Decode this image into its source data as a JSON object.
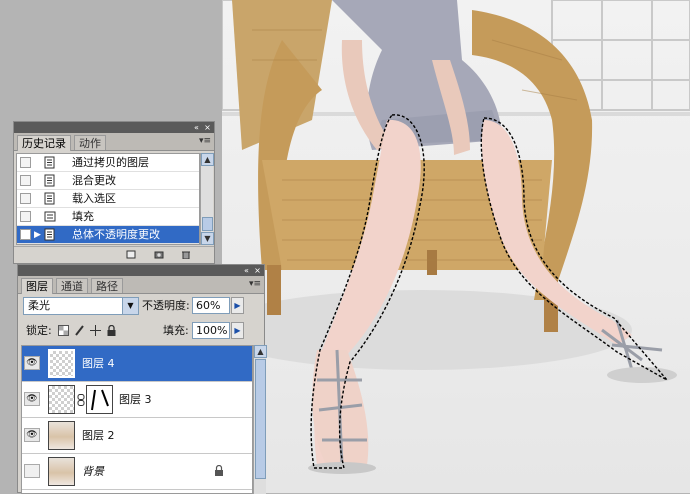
{
  "history_panel": {
    "tabs": [
      "历史记录",
      "动作"
    ],
    "active_tab": "历史记录",
    "items": [
      {
        "label": "通过拷贝的图层",
        "selected": false
      },
      {
        "label": "混合更改",
        "selected": false
      },
      {
        "label": "载入选区",
        "selected": false
      },
      {
        "label": "填充",
        "selected": false
      },
      {
        "label": "总体不透明度更改",
        "selected": true
      }
    ],
    "selection_color": "#316ac5"
  },
  "layers_panel": {
    "tabs": [
      "图层",
      "通道",
      "路径"
    ],
    "active_tab": "图层",
    "blend_mode": "柔光",
    "opacity_label": "不透明度:",
    "opacity_value": "60%",
    "lock_label": "锁定:",
    "fill_label": "填充:",
    "fill_value": "100%",
    "layers": [
      {
        "name": "图层 4",
        "visible": true,
        "selected": true,
        "thumbnail": "transparent",
        "mask": false
      },
      {
        "name": "图层 3",
        "visible": true,
        "selected": false,
        "thumbnail": "transparent",
        "mask": true
      },
      {
        "name": "图层 2",
        "visible": true,
        "selected": false,
        "thumbnail": "photo",
        "mask": false
      },
      {
        "name": "背景",
        "visible": false,
        "selected": false,
        "thumbnail": "photo",
        "mask": false,
        "locked": true
      }
    ]
  },
  "canvas": {
    "content": "photo of seated woman in wicker chair with marching-ants selection around legs",
    "icon": "photo-canvas"
  }
}
